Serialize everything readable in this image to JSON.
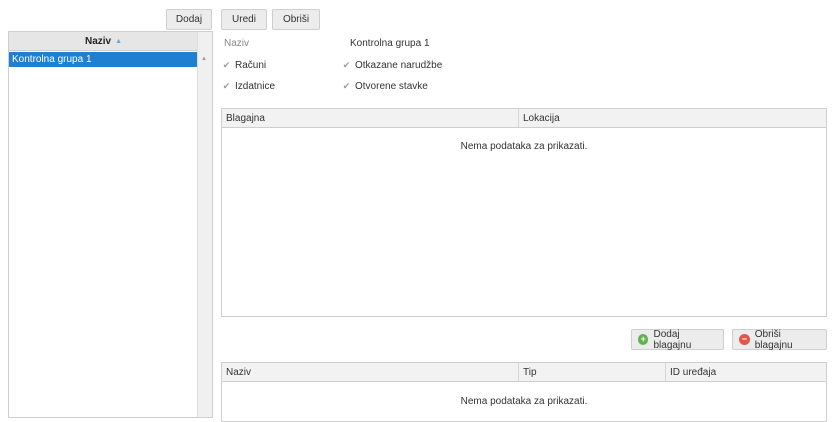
{
  "left": {
    "add_label": "Dodaj",
    "column_header": "Naziv",
    "sort_icon": "sort-asc-icon",
    "items": [
      {
        "label": "Kontrolna grupa 1",
        "selected": true
      }
    ]
  },
  "toolbar": {
    "edit_label": "Uredi",
    "delete_label": "Obriši"
  },
  "details": {
    "name_label": "Naziv",
    "name_value": "Kontrolna grupa 1",
    "checkboxes": [
      {
        "label": "Računi",
        "checked": true
      },
      {
        "label": "Otkazane narudžbe",
        "checked": true
      },
      {
        "label": "Izdatnice",
        "checked": true
      },
      {
        "label": "Otvorene stavke",
        "checked": true
      }
    ]
  },
  "registers_grid": {
    "columns": [
      "Blagajna",
      "Lokacija"
    ],
    "empty_text": "Nema podataka za prikazati."
  },
  "register_actions": {
    "add_label": "Dodaj blagajnu",
    "add_icon": "plus-circle-icon",
    "delete_label": "Obriši blagajnu",
    "delete_icon": "minus-circle-icon"
  },
  "devices_grid": {
    "columns": [
      "Naziv",
      "Tip",
      "ID uređaja"
    ],
    "empty_text": "Nema podataka za prikazati."
  },
  "colors": {
    "selection": "#1f7fd0",
    "add_icon": "#5fb34e",
    "delete_icon": "#e0574c"
  }
}
